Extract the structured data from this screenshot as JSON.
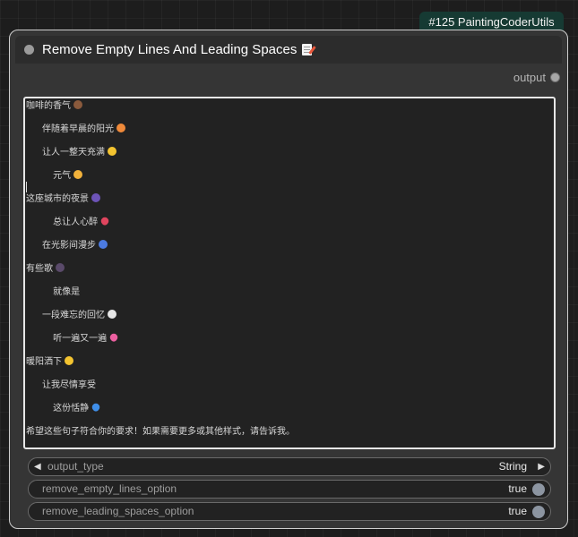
{
  "badge": "#125 PaintingCoderUtils",
  "node": {
    "title": "Remove Empty Lines And Leading Spaces",
    "title_icon": "memo-icon",
    "output_label": "output"
  },
  "text_lines": [
    {
      "text": "咖啡的香气",
      "emoji_color": "#8a5a3c"
    },
    {
      "text": "   伴随着早晨的阳光",
      "emoji_color": "#f08a3a"
    },
    {
      "text": "   让人一整天充满",
      "emoji_color": "#f4c430"
    },
    {
      "text": "     元气",
      "emoji_color": "#f2b23b"
    },
    {
      "text": "这座城市的夜景",
      "emoji_color": "#6d54b8"
    },
    {
      "text": "     总让人心醉",
      "emoji_color": "#e0455e",
      "heart": true
    },
    {
      "text": "   在光影间漫步",
      "emoji_color": "#4c7be0"
    },
    {
      "text": "有些歌",
      "emoji_color": "#5a4a6a"
    },
    {
      "text": "     就像是",
      "emoji_color": ""
    },
    {
      "text": "   一段难忘的回忆",
      "emoji_color": "#e6e6e6"
    },
    {
      "text": "     听一遍又一遍",
      "emoji_color": "#ec5fa0",
      "heart": true
    },
    {
      "text": "暖阳洒下",
      "emoji_color": "#f4c430"
    },
    {
      "text": "   让我尽情享受",
      "emoji_color": ""
    },
    {
      "text": "     这份恬静",
      "emoji_color": "#3f8ee8",
      "heart": true
    },
    {
      "text": "希望这些句子符合你的要求！如果需要更多或其他样式，请告诉我。",
      "emoji_color": ""
    }
  ],
  "widgets": {
    "output_type": {
      "name": "output_type",
      "value": "String"
    },
    "remove_empty_lines": {
      "name": "remove_empty_lines_option",
      "value": "true"
    },
    "remove_leading_spaces": {
      "name": "remove_leading_spaces_option",
      "value": "true"
    }
  },
  "colors": {
    "badge_bg": "#163a33",
    "node_border": "#cfcfcf",
    "node_bg": "#353535",
    "text_area_bg": "#222222",
    "toggle_on": "#8c95a1"
  }
}
